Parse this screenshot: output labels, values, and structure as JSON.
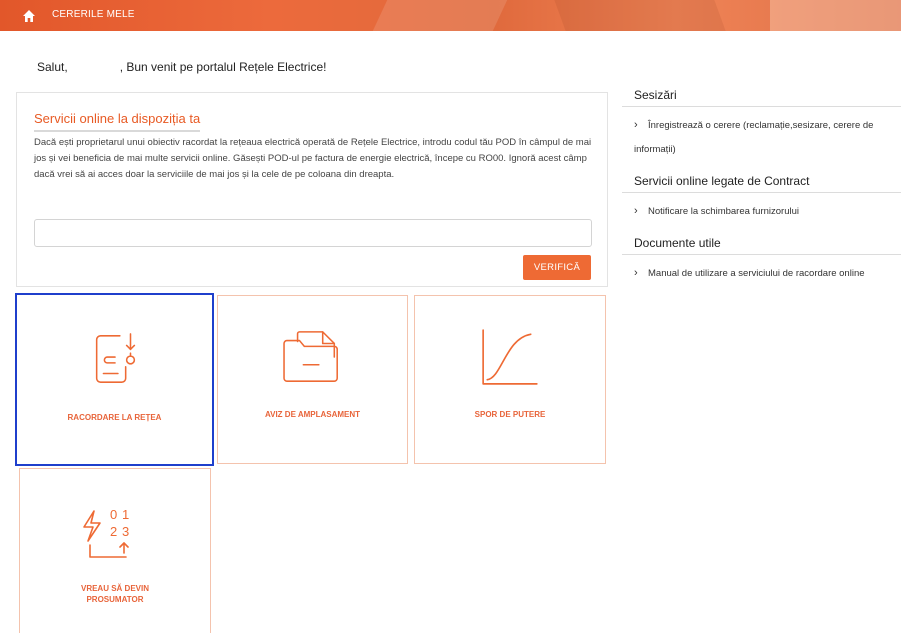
{
  "header": {
    "breadcrumb": "CERERILE MELE"
  },
  "greeting": {
    "prefix": "Salut,",
    "suffix": ", Bun venit pe portalul Rețele Electrice!"
  },
  "services_card": {
    "title": "Servicii online la dispoziția ta",
    "description": "Dacă ești proprietarul unui obiectiv racordat la rețeaua electrică operată de Rețele Electrice, introdu codul tău POD în câmpul de mai jos și vei beneficia de mai multe servicii online. Găsești POD-ul pe factura de energie electrică, începe cu RO00. Ignoră acest câmp dacă vrei să ai acces doar la serviciile de mai jos și la cele de pe coloana din dreapta.",
    "pod_input_value": "",
    "verify_label": "VERIFICĂ"
  },
  "tiles": [
    {
      "label": "RACORDARE LA REȚEA",
      "icon": "connection-request-icon",
      "selected": true
    },
    {
      "label": "AVIZ DE AMPLASAMENT",
      "icon": "folder-document-icon",
      "selected": false
    },
    {
      "label": "SPOR DE PUTERE",
      "icon": "power-curve-icon",
      "selected": false
    },
    {
      "label": "VREAU SĂ DEVIN PROSUMATOR",
      "icon": "prosumer-energy-icon",
      "selected": false
    }
  ],
  "sidebar": {
    "sections": [
      {
        "title": "Sesizări",
        "links": [
          "Înregistrează o cerere (reclamație,sesizare, cerere de informații)"
        ]
      },
      {
        "title": "Servicii online legate de Contract",
        "links": [
          "Notificare la schimbarea furnizorului"
        ]
      },
      {
        "title": "Documente utile",
        "links": [
          "Manual de utilizare a serviciului de racordare online"
        ]
      }
    ]
  },
  "colors": {
    "accent": "#ee6a34",
    "selection_border": "#1f3fcc",
    "tile_border": "#f4c3ad"
  }
}
